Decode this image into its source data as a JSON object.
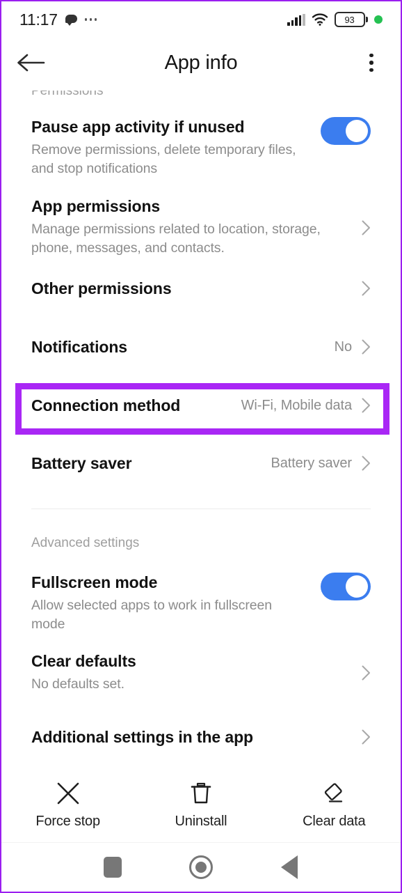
{
  "status_bar": {
    "time": "11:17",
    "notification_icon": "speech-bubble-icon",
    "overflow_icon": "more-horizontal-icon",
    "signal_icon": "cellular-signal-icon",
    "wifi_icon": "wifi-icon",
    "battery_level": "93",
    "indicator_dot_color": "#25c152"
  },
  "app_bar": {
    "back_icon": "arrow-left-icon",
    "title": "App info",
    "overflow_icon": "more-vertical-icon"
  },
  "colors": {
    "accent_toggle": "#3b7def",
    "highlight": "#a927f5",
    "title_text": "#121212",
    "secondary_text": "#8c8c8c"
  },
  "sections": {
    "permissions_label": "Permissions",
    "advanced_label": "Advanced settings"
  },
  "rows": [
    {
      "title": "Pause app activity if unused",
      "subtitle": "Remove permissions, delete temporary files, and stop notifications",
      "control": "toggle",
      "toggle_on": true
    },
    {
      "title": "App permissions",
      "subtitle": "Manage permissions related to location, storage, phone, messages, and contacts.",
      "control": "chevron",
      "value": ""
    },
    {
      "title": "Other permissions",
      "subtitle": "",
      "control": "chevron",
      "value": ""
    },
    {
      "title": "Notifications",
      "subtitle": "",
      "control": "chevron",
      "value": "No"
    },
    {
      "title": "Connection method",
      "subtitle": "",
      "control": "chevron",
      "value": "Wi-Fi, Mobile data",
      "highlighted": true
    },
    {
      "title": "Battery saver",
      "subtitle": "",
      "control": "chevron",
      "value": "Battery saver"
    },
    {
      "title": "Fullscreen mode",
      "subtitle": "Allow selected apps to work in fullscreen mode",
      "control": "toggle",
      "toggle_on": true
    },
    {
      "title": "Clear defaults",
      "subtitle": "No defaults set.",
      "control": "chevron",
      "value": ""
    },
    {
      "title": "Additional settings in the app",
      "subtitle": "",
      "control": "chevron",
      "value": ""
    }
  ],
  "actions": [
    {
      "label": "Force stop",
      "icon": "close-x-icon"
    },
    {
      "label": "Uninstall",
      "icon": "trash-icon"
    },
    {
      "label": "Clear data",
      "icon": "eraser-icon"
    }
  ],
  "nav_bar": [
    {
      "name": "recents",
      "icon": "square-icon"
    },
    {
      "name": "home",
      "icon": "circle-icon"
    },
    {
      "name": "back",
      "icon": "triangle-left-icon"
    }
  ]
}
